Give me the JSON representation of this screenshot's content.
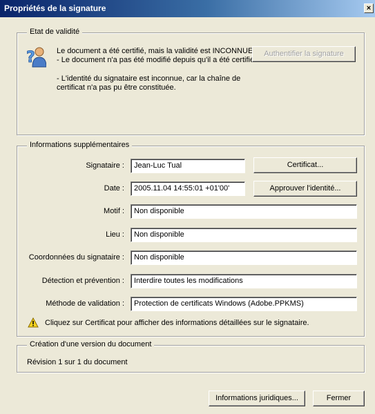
{
  "window": {
    "title": "Propriétés de la signature",
    "close_label": "×"
  },
  "validity": {
    "legend": "Etat de validité",
    "icon": "question-user-icon",
    "status_line1": "Le document a été certifié, mais la validité est INCONNUE.",
    "status_line2": "- Le document n'a pas été modifié depuis qu'il a été certifié.",
    "detail_line1": "- L'identité du signataire est inconnue, car la chaîne de",
    "detail_line2": "certificat n'a pas pu être constituée.",
    "authenticate_button": "Authentifier la signature"
  },
  "info": {
    "legend": "Informations supplémentaires",
    "signer_label": "Signataire :",
    "signer_value": "Jean-Luc Tual",
    "certificate_button": "Certificat...",
    "date_label": "Date :",
    "date_value": "2005.11.04 14:55:01 +01'00'",
    "approve_button": "Approuver l'identité...",
    "reason_label": "Motif :",
    "reason_value": "Non disponible",
    "location_label": "Lieu :",
    "location_value": "Non disponible",
    "contact_label": "Coordonnées du signataire :",
    "contact_value": "Non disponible",
    "detection_label": "Détection et prévention :",
    "detection_value": "Interdire toutes les modifications",
    "method_label": "Méthode de validation :",
    "method_value": "Protection de certificats Windows (Adobe.PPKMS)",
    "warning_icon": "warning-icon",
    "warning_text": "Cliquez sur Certificat pour afficher des informations détaillées sur le signataire."
  },
  "version": {
    "legend": "Création d'une version du document",
    "revision_text": "Révision 1 sur 1 du document"
  },
  "footer": {
    "legal_button": "Informations juridiques...",
    "close_button": "Fermer"
  }
}
